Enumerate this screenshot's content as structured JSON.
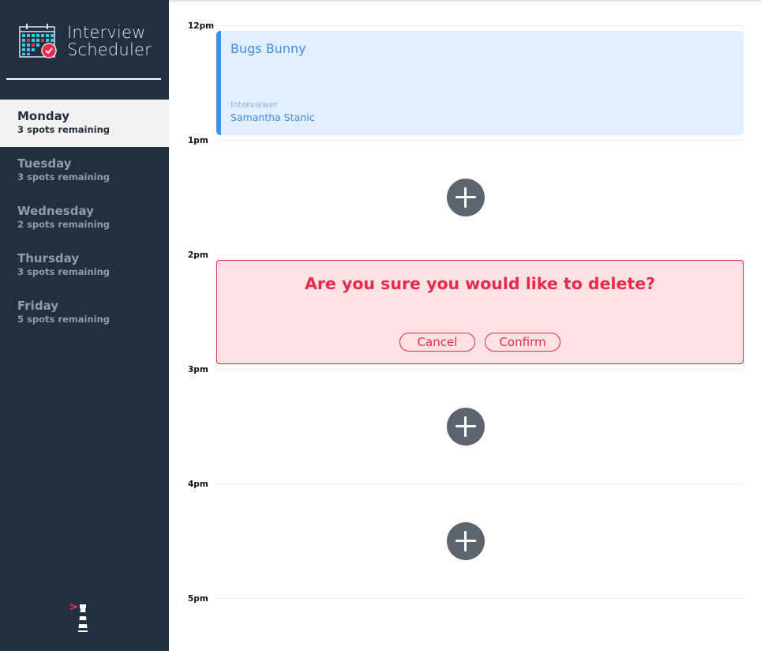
{
  "app": {
    "title_line1": "Interview",
    "title_line2": "Scheduler",
    "colors": {
      "sidebar": "#222f3e",
      "accent_blue": "#3d8fe8",
      "danger": "#e8294c",
      "add_button": "#5c646e"
    }
  },
  "sidebar": {
    "days": [
      {
        "name": "Monday",
        "spots": "3 spots remaining",
        "selected": true
      },
      {
        "name": "Tuesday",
        "spots": "3 spots remaining",
        "selected": false
      },
      {
        "name": "Wednesday",
        "spots": "2 spots remaining",
        "selected": false
      },
      {
        "name": "Thursday",
        "spots": "3 spots remaining",
        "selected": false
      },
      {
        "name": "Friday",
        "spots": "5 spots remaining",
        "selected": false
      }
    ],
    "footer_icon": "lighthouse-icon"
  },
  "schedule": {
    "times": [
      "12pm",
      "1pm",
      "2pm",
      "3pm",
      "4pm",
      "5pm"
    ],
    "appointment": {
      "student": "Bugs Bunny",
      "interviewer_label": "Interviewer",
      "interviewer": "Samantha Stanic"
    },
    "confirm": {
      "message": "Are you sure you would like to delete?",
      "cancel_label": "Cancel",
      "confirm_label": "Confirm"
    },
    "add_icon": "plus-icon"
  }
}
